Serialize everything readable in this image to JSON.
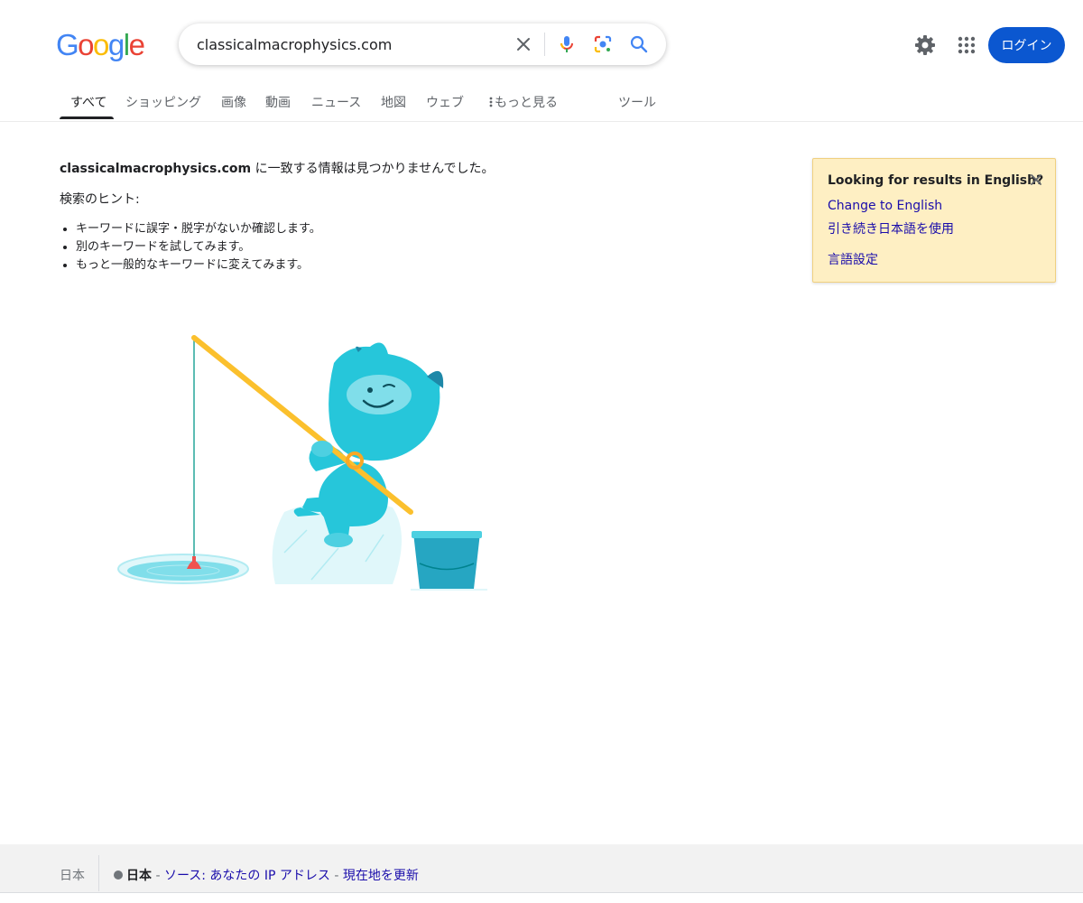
{
  "logo": {
    "letters": [
      "G",
      "o",
      "o",
      "g",
      "l",
      "e"
    ],
    "colors": [
      "#4285f4",
      "#ea4335",
      "#fbbc05",
      "#4285f4",
      "#34a853",
      "#ea4335"
    ]
  },
  "search": {
    "value": "classicalmacrophysics.com"
  },
  "header": {
    "login_label": "ログイン"
  },
  "tabs": [
    {
      "label": "すべて",
      "active": true
    },
    {
      "label": "ショッピング"
    },
    {
      "label": "画像"
    },
    {
      "label": "動画"
    },
    {
      "label": "ニュース"
    },
    {
      "label": "地図"
    },
    {
      "label": "ウェブ"
    },
    {
      "label": "もっと見る"
    },
    {
      "label": "ツール"
    }
  ],
  "main": {
    "query_bold": "classicalmacrophysics.com",
    "no_results_suffix": " に一致する情報は見つかりませんでした。",
    "hints_title": "検索のヒント:",
    "hints": [
      "キーワードに誤字・脱字がないか確認します。",
      "別のキーワードを試してみます。",
      "もっと一般的なキーワードに変えてみます。"
    ]
  },
  "lang_card": {
    "title": "Looking for results in English?",
    "change_link": "Change to English",
    "keep_link": "引き続き日本語を使用",
    "settings_link": "言語設定"
  },
  "footer": {
    "country": "日本",
    "location_bold": "日本",
    "dash1": " - ",
    "source_link": "ソース: あなたの IP アドレス",
    "dash2": " - ",
    "update_link": "現在地を更新"
  },
  "colors": {
    "accent": "#0b57d0",
    "link": "#1a0dab",
    "card_bg": "#feefc3"
  }
}
